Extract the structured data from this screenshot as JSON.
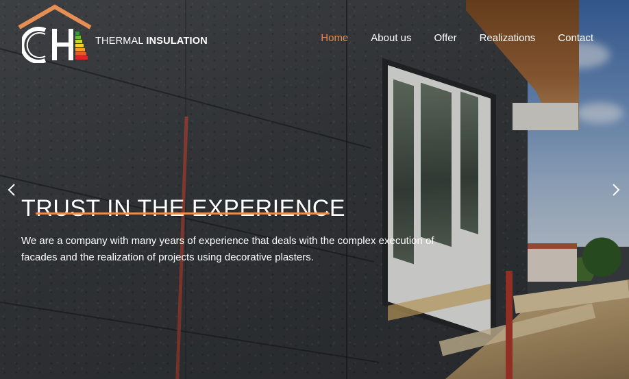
{
  "brand": {
    "logo_letters": "CH",
    "name_light": "THERMAL",
    "name_bold": "INSULATION",
    "accent_color": "#e68f55"
  },
  "nav": {
    "items": [
      {
        "label": "Home",
        "active": true
      },
      {
        "label": "About us",
        "active": false
      },
      {
        "label": "Offer",
        "active": false
      },
      {
        "label": "Realizations",
        "active": false
      },
      {
        "label": "Contact",
        "active": false
      }
    ]
  },
  "hero": {
    "title": "TRUST IN THE EXPERIENCE",
    "description": "We are a company with many years of experience that deals with the complex execution of facades and the realization of projects using decorative plasters.",
    "prev_icon": "chevron-left-icon",
    "next_icon": "chevron-right-icon"
  }
}
